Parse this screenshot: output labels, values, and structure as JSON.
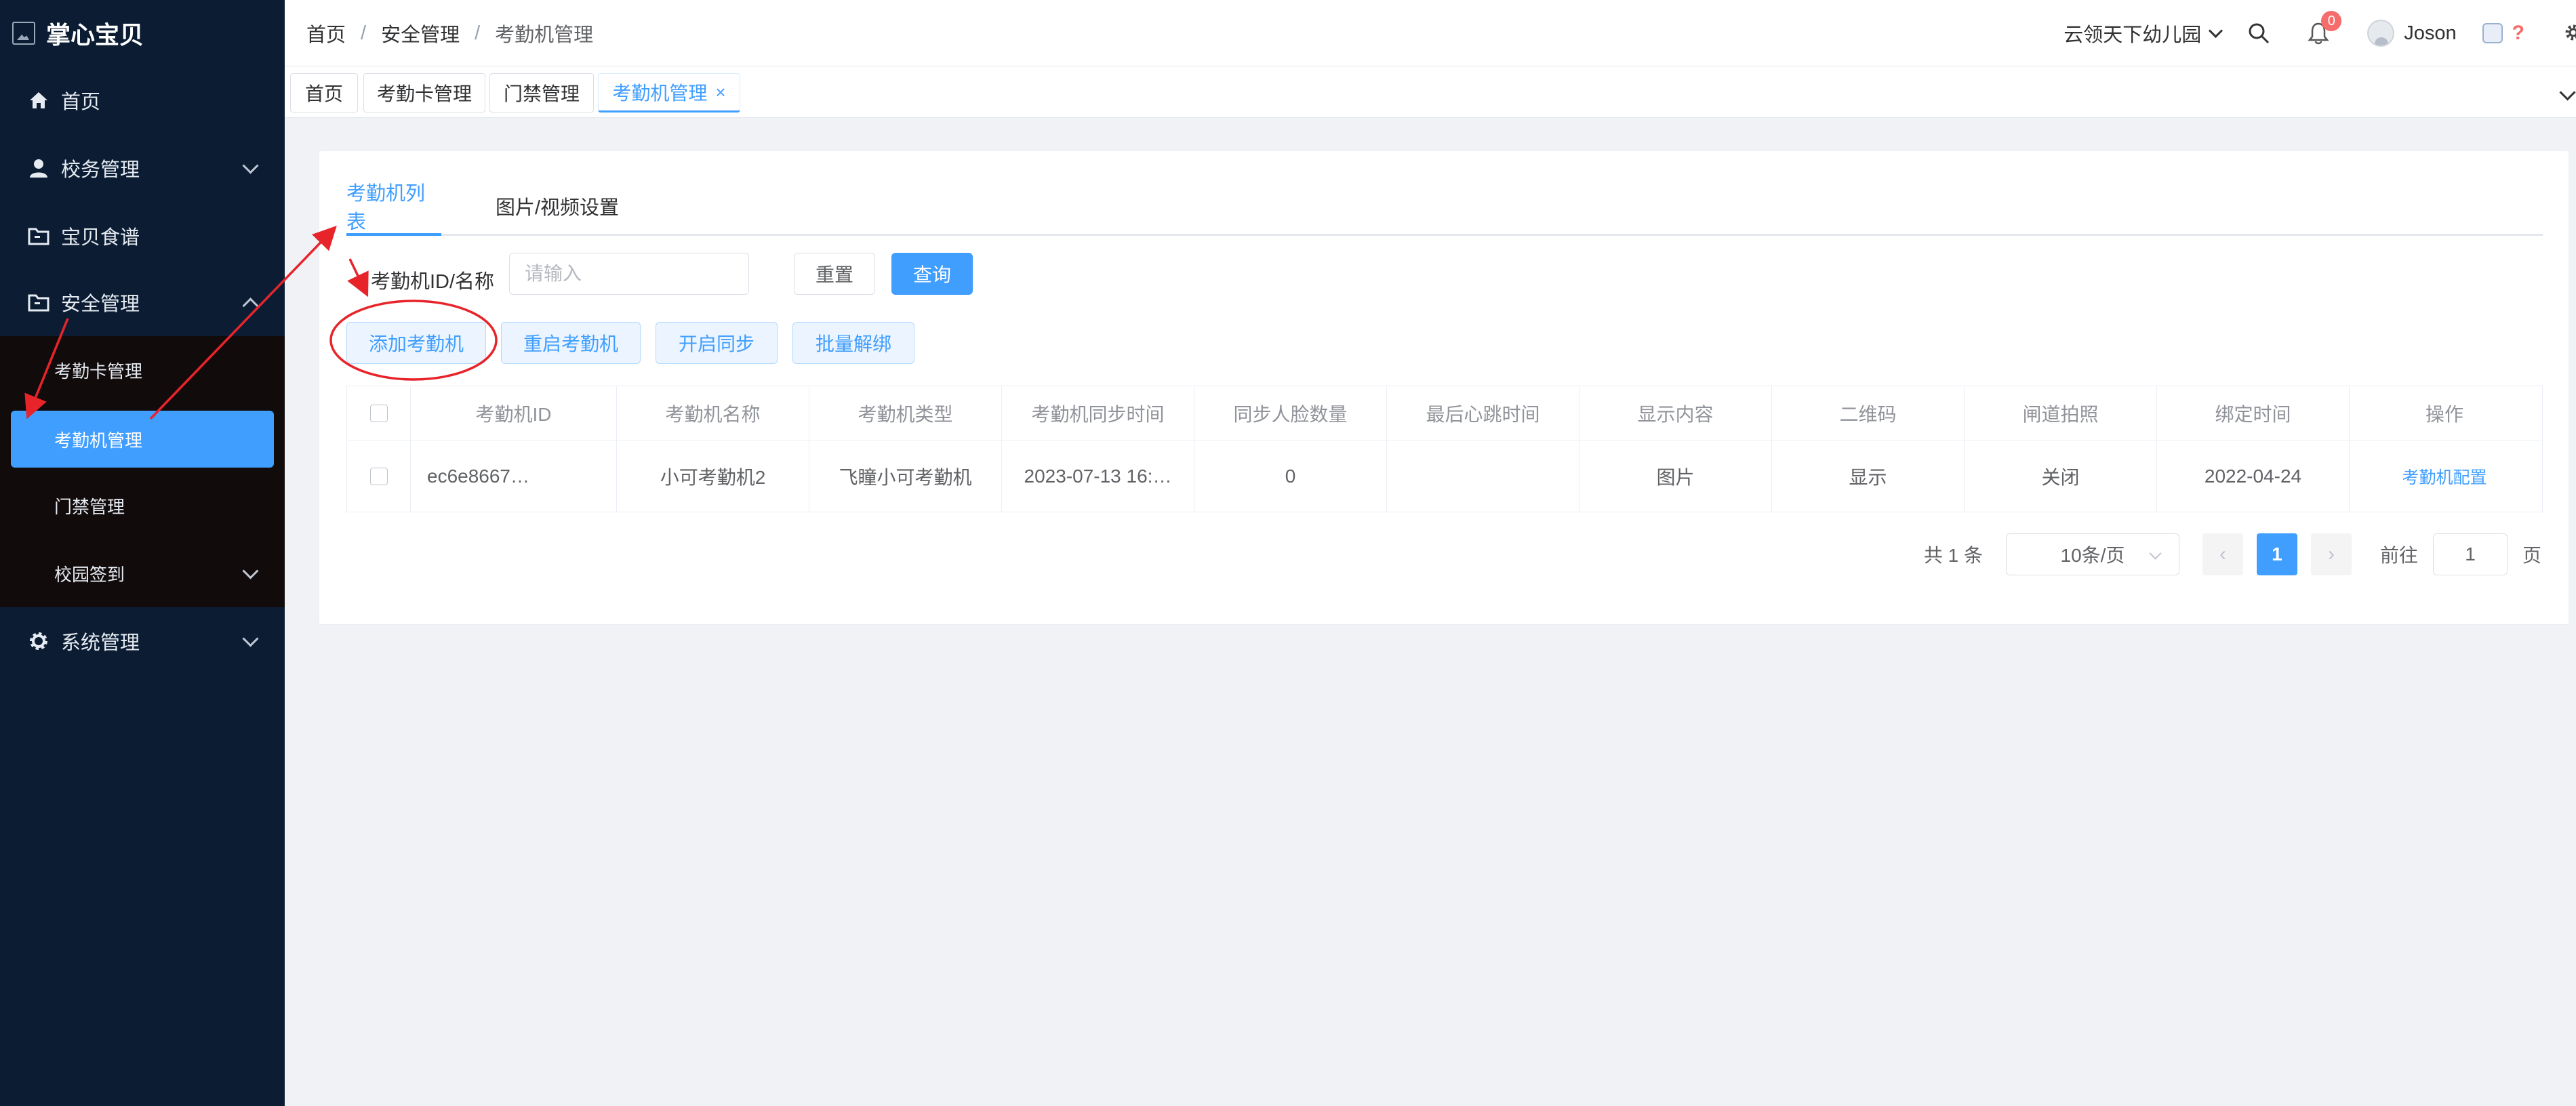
{
  "app": {
    "title": "掌心宝贝"
  },
  "sidebar": {
    "items": [
      {
        "label": "首页",
        "icon": "home-icon"
      },
      {
        "label": "校务管理",
        "icon": "user-icon"
      },
      {
        "label": "宝贝食谱",
        "icon": "folder-icon"
      },
      {
        "label": "安全管理",
        "icon": "folder-icon",
        "expanded": true
      },
      {
        "label": "系统管理",
        "icon": "gear-icon"
      }
    ],
    "submenu": [
      {
        "label": "考勤卡管理"
      },
      {
        "label": "考勤机管理",
        "active": true
      },
      {
        "label": "门禁管理"
      },
      {
        "label": "校园签到"
      }
    ]
  },
  "header": {
    "breadcrumb": [
      "首页",
      "安全管理",
      "考勤机管理"
    ],
    "school": "云领天下幼儿园",
    "notification_count": "0",
    "username": "Joson",
    "help": "?"
  },
  "page_tabs": [
    {
      "label": "首页"
    },
    {
      "label": "考勤卡管理"
    },
    {
      "label": "门禁管理"
    },
    {
      "label": "考勤机管理",
      "active": true,
      "close": "×"
    }
  ],
  "content": {
    "tabs": [
      {
        "label": "考勤机列表",
        "active": true
      },
      {
        "label": "图片/视频设置"
      }
    ],
    "search": {
      "label": "考勤机ID/名称",
      "placeholder": "请输入",
      "reset": "重置",
      "query": "查询"
    },
    "actions": {
      "add": "添加考勤机",
      "restart": "重启考勤机",
      "sync": "开启同步",
      "unbind": "批量解绑"
    },
    "table": {
      "columns": [
        "考勤机ID",
        "考勤机名称",
        "考勤机类型",
        "考勤机同步时间",
        "同步人脸数量",
        "最后心跳时间",
        "显示内容",
        "二维码",
        "闸道拍照",
        "绑定时间",
        "操作"
      ],
      "rows": [
        {
          "id": "ec6e8667…",
          "name": "小可考勤机2",
          "type": "飞瞳小可考勤机",
          "sync_time": "2023-07-13 16:…",
          "face_count": "0",
          "last_heartbeat": "",
          "display": "图片",
          "qrcode": "显示",
          "gate_photo": "关闭",
          "bind_time": "2022-04-24",
          "action": "考勤机配置"
        }
      ]
    },
    "pagination": {
      "total": "共 1 条",
      "page_size": "10条/页",
      "current_page": "1",
      "goto_label": "前往",
      "goto_value": "1",
      "page_suffix": "页"
    }
  },
  "colors": {
    "sidebar_bg": "#0b1c33",
    "accent": "#409eff",
    "annotation": "#e8242b"
  }
}
